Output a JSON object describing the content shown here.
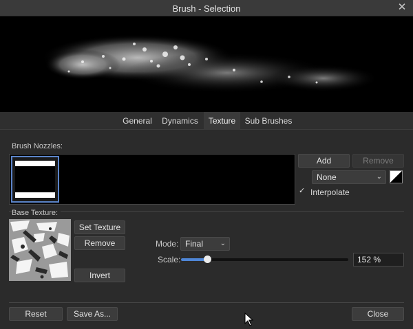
{
  "window": {
    "title": "Brush - Selection",
    "close_icon": "close-icon"
  },
  "tabs": [
    {
      "label": "General",
      "active": false
    },
    {
      "label": "Dynamics",
      "active": false
    },
    {
      "label": "Texture",
      "active": true
    },
    {
      "label": "Sub Brushes",
      "active": false
    }
  ],
  "nozzles": {
    "label": "Brush Nozzles:",
    "add_label": "Add",
    "remove_label": "Remove",
    "blend_select": "None",
    "interpolate_label": "Interpolate",
    "interpolate_checked": true
  },
  "base_texture": {
    "label": "Base Texture:",
    "set_texture_label": "Set Texture",
    "remove_label": "Remove",
    "invert_label": "Invert",
    "mode_label": "Mode:",
    "mode_value": "Final",
    "scale_label": "Scale:",
    "scale_value": "152 %",
    "scale_fraction": 0.155
  },
  "footer": {
    "reset_label": "Reset",
    "save_as_label": "Save As...",
    "close_label": "Close"
  },
  "colors": {
    "accent": "#4f86d6",
    "selection_border": "#5b84c9"
  }
}
